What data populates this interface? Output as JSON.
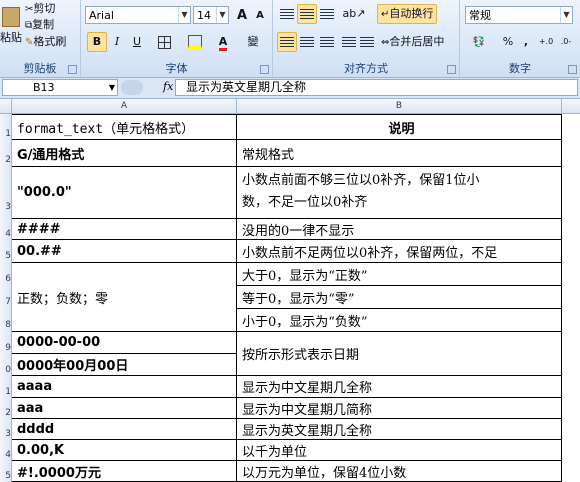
{
  "ribbon": {
    "clipboard": {
      "label": "剪贴板",
      "paste": "粘贴",
      "cut": "剪切",
      "copy": "复制",
      "format_painter": "格式刷"
    },
    "font": {
      "label": "字体",
      "font_name": "Arial",
      "font_size": "14",
      "bold": "B",
      "italic": "I",
      "underline": "U",
      "grow": "A",
      "shrink": "A",
      "phonetic": "變"
    },
    "alignment": {
      "label": "对齐方式",
      "wrap_text": "自动换行",
      "merge_center": "合并后居中"
    },
    "number": {
      "label": "数字",
      "format": "常规",
      "percent": "%",
      "comma": ","
    }
  },
  "formula_bar": {
    "cell_ref": "B13",
    "fx": "fx",
    "content": "显示为英文星期几全称"
  },
  "columns": [
    "A",
    "B"
  ],
  "rows": [
    {
      "num": "1",
      "a": "format_text（单元格格式）",
      "b": "说明"
    },
    {
      "num": "2",
      "a": "G/通用格式",
      "b": "常规格式"
    },
    {
      "num": "3",
      "a": "\"000.0\"",
      "b": "小数点前面不够三位以0补齐，保留1位小",
      "b2": "数，不足一位以0补齐"
    },
    {
      "num": "4",
      "a": "####",
      "b": "没用的0一律不显示"
    },
    {
      "num": "5",
      "a": "00.##",
      "b": "小数点前不足两位以0补齐，保留两位，不足"
    },
    {
      "num": "6",
      "a": "正数；负数；零",
      "b": "大于0，显示为“正数”"
    },
    {
      "num": "7",
      "b": "等于0，显示为“零”"
    },
    {
      "num": "8",
      "b": "小于0，显示为“负数”"
    },
    {
      "num": "9",
      "a": "0000-00-00",
      "b": "按所示形式表示日期"
    },
    {
      "num": "0",
      "a": "0000年00月00日"
    },
    {
      "num": "1",
      "a": "aaaa",
      "b": "显示为中文星期几全称"
    },
    {
      "num": "2",
      "a": "aaa",
      "b": "显示为中文星期几简称"
    },
    {
      "num": "3",
      "a": "dddd",
      "b": "显示为英文星期几全称"
    },
    {
      "num": "4",
      "a": "0.00,K",
      "b": "以千为单位"
    },
    {
      "num": "5",
      "a": "#!.0000万元",
      "b": "以万元为单位，保留4位小数"
    }
  ],
  "colors": {
    "ribbon_bg": "#dbe6f4",
    "grid_border": "#000000",
    "highlight": "#fce4a0"
  }
}
